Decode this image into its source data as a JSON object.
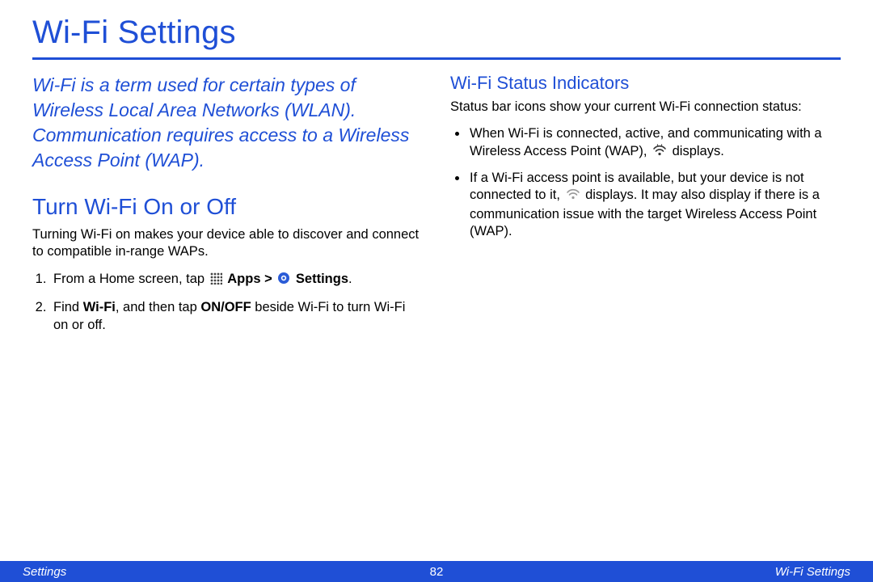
{
  "title": "Wi-Fi Settings",
  "intro": "Wi-Fi is a term used for certain types of Wireless Local Area Networks (WLAN). Communication requires access to a Wireless Access Point (WAP).",
  "left": {
    "heading": "Turn Wi-Fi On or Off",
    "para": "Turning Wi-Fi on makes your device able to discover and connect to compatible in-range WAPs.",
    "step1_a": "From a Home screen, tap ",
    "step1_apps": "Apps",
    "step1_gt": " > ",
    "step1_settings": "Settings",
    "step1_end": ".",
    "step2_a": "Find ",
    "step2_wifi": "Wi-Fi",
    "step2_b": ", and then tap ",
    "step2_onoff": "ON/OFF",
    "step2_c": " beside Wi-Fi to turn Wi-Fi on or off."
  },
  "right": {
    "heading": "Wi-Fi Status Indicators",
    "para": "Status bar icons show your current Wi-Fi connection status:",
    "bullet1_a": "When Wi-Fi is connected, active, and communicating with a Wireless Access Point (WAP), ",
    "bullet1_b": " displays.",
    "bullet2_a": "If a Wi-Fi access point is available, but your device is not connected to it, ",
    "bullet2_b": " displays. It may also display if there is a communication issue with the target Wireless Access Point (WAP)."
  },
  "footer": {
    "left": "Settings",
    "page": "82",
    "right": "Wi-Fi Settings"
  }
}
